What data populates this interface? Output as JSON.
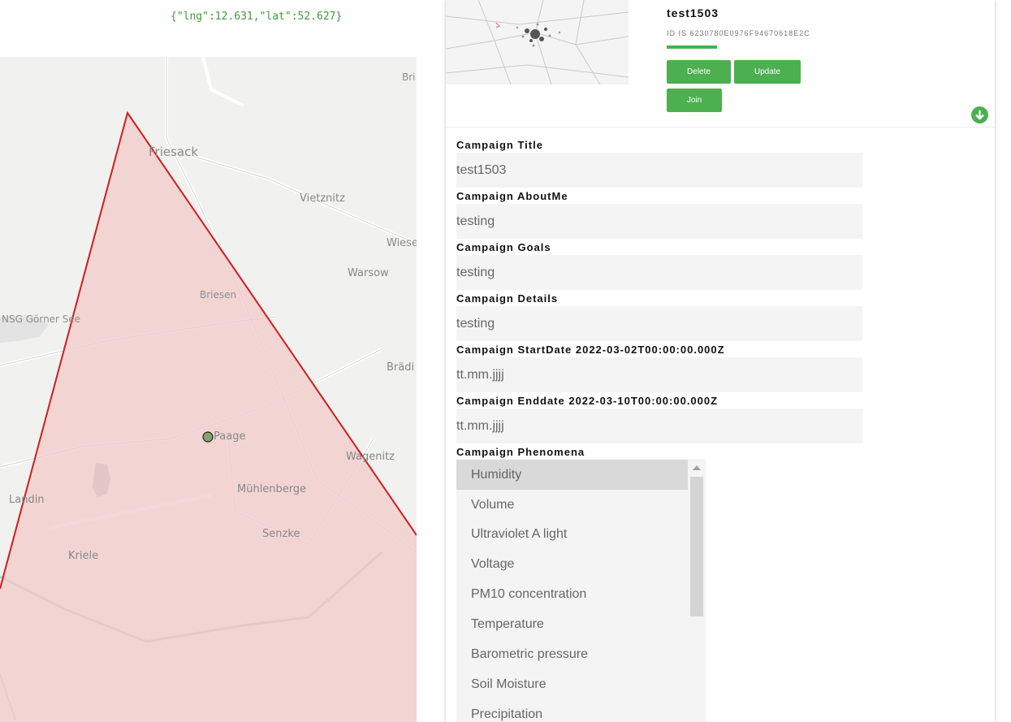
{
  "coords_readout": "{\"lng\":12.631,\"lat\":52.627}",
  "map": {
    "places": [
      "Bri",
      "Friesack",
      "Vietznitz",
      "Wiese",
      "Warsow",
      "Briesen",
      "NSG Görner See",
      "Brädi",
      "Paage",
      "Wagenitz",
      "Mühlenberge",
      "Landin",
      "Senzke",
      "Kriele"
    ],
    "polygon_color": "#cc1f1f",
    "polygon_fill": "#f2caca"
  },
  "campaign": {
    "title": "test1503",
    "id_line": "ID IS 6230780E0976F94670618E2C",
    "buttons": {
      "delete": "Delete",
      "update": "Update",
      "join": "Join"
    },
    "accent": "#4caf50"
  },
  "form": {
    "title_label": "Campaign Title",
    "title_value": "test1503",
    "about_label": "Campaign AboutMe",
    "about_value": "testing",
    "goals_label": "Campaign Goals",
    "goals_value": "testing",
    "details_label": "Campaign Details",
    "details_value": "testing",
    "start_label": "Campaign StartDate 2022-03-02T00:00:00.000Z",
    "start_placeholder": "tt.mm.jjjj",
    "end_label": "Campaign Enddate 2022-03-10T00:00:00.000Z",
    "end_placeholder": "tt.mm.jjjj",
    "phenomena_label": "Campaign Phenomena",
    "phenomena": [
      "Humidity",
      "Volume",
      "Ultraviolet A light",
      "Voltage",
      "PM10 concentration",
      "Temperature",
      "Barometric pressure",
      "Soil Moisture",
      "Precipitation"
    ],
    "phenomena_selected": "Humidity"
  }
}
